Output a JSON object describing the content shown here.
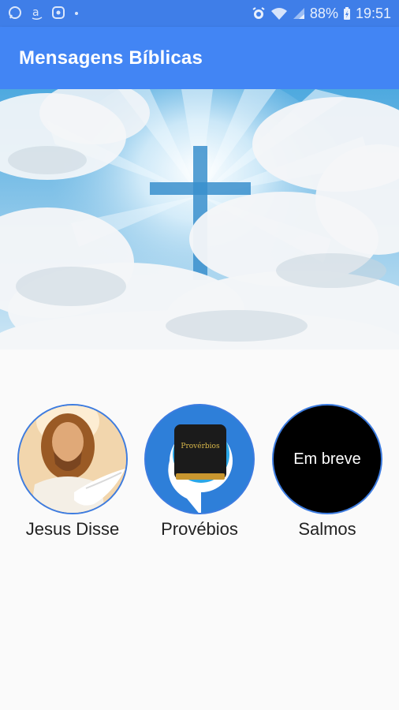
{
  "status_bar": {
    "icons_left": [
      "whatsapp-icon",
      "amazon-icon",
      "shield-icon",
      "dot-icon"
    ],
    "battery_percent": "88%",
    "time": "19:51"
  },
  "app_bar": {
    "title": "Mensagens Bíblicas",
    "color": "#4285f4"
  },
  "hero": {
    "image": "cross-in-clouds"
  },
  "menu": {
    "items": [
      {
        "label": "Jesus Disse",
        "icon": "jesus-portrait"
      },
      {
        "label": "Provébios",
        "icon": "bible-book-icon",
        "book_title": "Provérbios"
      },
      {
        "label": "Salmos",
        "icon": "coming-soon",
        "badge": "Em breve"
      }
    ]
  }
}
